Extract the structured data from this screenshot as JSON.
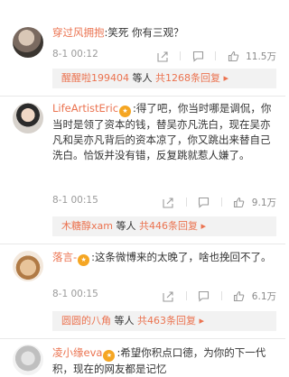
{
  "comments": [
    {
      "username": "穿过风拥抱",
      "text": ":笑死 你有三观？",
      "time": "8-1 00:12",
      "likes": "11.5万",
      "reply": {
        "user": "醒醒啦199404",
        "mid": " 等人 ",
        "count": "共1268条回复",
        "arrow": " ▸"
      }
    },
    {
      "username": "LifeArtistEric",
      "badge": "★",
      "text": ":得了吧，你当时哪是调侃，你当时是领了资本的钱，替吴亦凡洗白，现在吴亦凡和吴亦凡背后的资本凉了，你又跳出来替自己洗白。恰饭并没有错，反复跳就惹人嫌了。",
      "time": "8-1 00:15",
      "likes": "9.1万",
      "reply": {
        "user": "木糖醇xam",
        "mid": " 等人 ",
        "count": "共446条回复",
        "arrow": " ▸"
      }
    },
    {
      "username": "落言-",
      "badge": "★",
      "text": ":这条微博来的太晚了，啥也挽回不了。",
      "time": "8-1 00:15",
      "likes": "6.1万",
      "reply": {
        "user": "圆圆的八角",
        "mid": " 等人 ",
        "count": "共463条回复",
        "arrow": " ▸"
      }
    },
    {
      "username": "凌小缘eva",
      "badge": "★",
      "text": ":希望你积点口德，为你的下一代积，现在的网友都是记忆"
    }
  ],
  "colors": {
    "accent": "#eb7350",
    "meta": "#9a9a9a",
    "reply_bg": "#f2f2f2"
  },
  "icons": [
    "share-icon",
    "comment-icon",
    "like-icon"
  ]
}
